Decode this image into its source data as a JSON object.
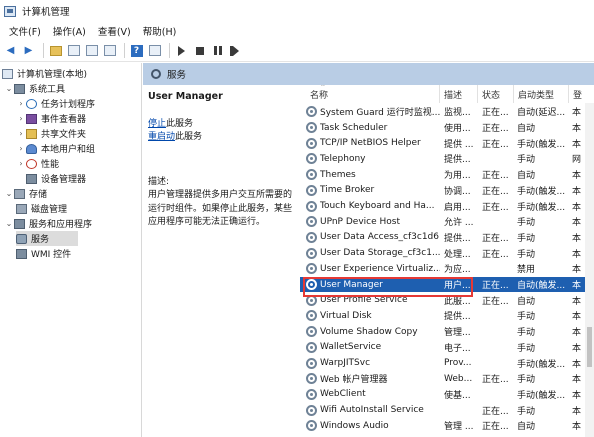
{
  "window": {
    "title": "计算机管理"
  },
  "menu": [
    "文件(F)",
    "操作(A)",
    "查看(V)",
    "帮助(H)"
  ],
  "toolbar": [
    "back-icon",
    "forward-icon",
    "folder-icon",
    "view-icon",
    "properties-icon",
    "export-icon",
    "help-icon",
    "console-icon",
    "start-icon",
    "stop-icon",
    "pause-icon",
    "restart-icon"
  ],
  "tree": {
    "root": "计算机管理(本地)",
    "system_tools": "系统工具",
    "task_scheduler": "任务计划程序",
    "event_viewer": "事件查看器",
    "shared_folders": "共享文件夹",
    "local_users": "本地用户和组",
    "performance": "性能",
    "device_manager": "设备管理器",
    "storage": "存储",
    "disk_management": "磁盘管理",
    "services_apps": "服务和应用程序",
    "services": "服务",
    "wmi": "WMI 控件"
  },
  "panel_header": "服务",
  "details": {
    "service_title": "User Manager",
    "stop_link": "停止",
    "stop_suffix": "此服务",
    "restart_link": "重启动",
    "restart_suffix": "此服务",
    "desc_label": "描述:",
    "desc_text": "用户管理器提供多用户交互所需要的运行时组件。如果停止此服务，某些应用程序可能无法正确运行。"
  },
  "columns": {
    "name": "名称",
    "desc": "描述",
    "status": "状态",
    "startup": "启动类型",
    "logon": "登"
  },
  "services": [
    {
      "name": "System Guard 运行时监视...",
      "desc": "监视...",
      "status": "正在...",
      "startup": "自动(延迟...",
      "logon": "本"
    },
    {
      "name": "Task Scheduler",
      "desc": "使用...",
      "status": "正在...",
      "startup": "自动",
      "logon": "本"
    },
    {
      "name": "TCP/IP NetBIOS Helper",
      "desc": "提供 ...",
      "status": "正在...",
      "startup": "手动(触发...",
      "logon": "本"
    },
    {
      "name": "Telephony",
      "desc": "提供...",
      "status": "",
      "startup": "手动",
      "logon": "网"
    },
    {
      "name": "Themes",
      "desc": "为用...",
      "status": "正在...",
      "startup": "自动",
      "logon": "本"
    },
    {
      "name": "Time Broker",
      "desc": "协调...",
      "status": "正在...",
      "startup": "手动(触发...",
      "logon": "本"
    },
    {
      "name": "Touch Keyboard and Ha...",
      "desc": "启用...",
      "status": "正在...",
      "startup": "手动(触发...",
      "logon": "本"
    },
    {
      "name": "UPnP Device Host",
      "desc": "允许 ...",
      "status": "",
      "startup": "手动",
      "logon": "本"
    },
    {
      "name": "User Data Access_cf3c1d6",
      "desc": "提供...",
      "status": "正在...",
      "startup": "手动",
      "logon": "本"
    },
    {
      "name": "User Data Storage_cf3c1...",
      "desc": "处理...",
      "status": "正在...",
      "startup": "手动",
      "logon": "本"
    },
    {
      "name": "User Experience Virtualiz...",
      "desc": "为应...",
      "status": "",
      "startup": "禁用",
      "logon": "本"
    },
    {
      "name": "User Manager",
      "desc": "用户...",
      "status": "正在...",
      "startup": "自动(触发...",
      "logon": "本",
      "selected": true
    },
    {
      "name": "User Profile Service",
      "desc": "此服...",
      "status": "正在...",
      "startup": "自动",
      "logon": "本"
    },
    {
      "name": "Virtual Disk",
      "desc": "提供...",
      "status": "",
      "startup": "手动",
      "logon": "本"
    },
    {
      "name": "Volume Shadow Copy",
      "desc": "管理...",
      "status": "",
      "startup": "手动",
      "logon": "本"
    },
    {
      "name": "WalletService",
      "desc": "电子...",
      "status": "",
      "startup": "手动",
      "logon": "本"
    },
    {
      "name": "WarpJITSvc",
      "desc": "Prov...",
      "status": "",
      "startup": "手动(触发...",
      "logon": "本"
    },
    {
      "name": "Web 帐户管理器",
      "desc": "Web...",
      "status": "正在...",
      "startup": "手动",
      "logon": "本"
    },
    {
      "name": "WebClient",
      "desc": "使基...",
      "status": "",
      "startup": "手动(触发...",
      "logon": "本"
    },
    {
      "name": "Wifi AutoInstall Service",
      "desc": "",
      "status": "正在...",
      "startup": "手动",
      "logon": "本"
    },
    {
      "name": "Windows Audio",
      "desc": "管理 ...",
      "status": "正在...",
      "startup": "自动",
      "logon": "本"
    }
  ]
}
